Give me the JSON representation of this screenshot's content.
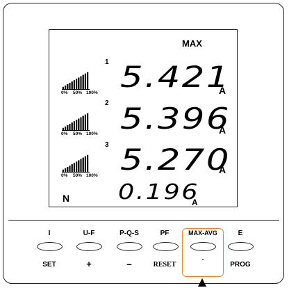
{
  "display": {
    "max_indicator": "MAX",
    "lines": [
      {
        "number": "1",
        "value": "5.421",
        "unit": "A",
        "bar_level": 1.0
      },
      {
        "number": "2",
        "value": "5.396",
        "unit": "A",
        "bar_level": 1.0
      },
      {
        "number": "3",
        "value": "5.270",
        "unit": "A",
        "bar_level": 1.0
      }
    ],
    "bar_scale": {
      "low": "0%",
      "mid": "50%",
      "high": "100%"
    },
    "neutral": {
      "label": "N",
      "value": "0.196",
      "unit": "A"
    }
  },
  "buttons": [
    {
      "top": "I",
      "bottom": "SET"
    },
    {
      "top": "U-F",
      "bottom": "+"
    },
    {
      "top": "P-Q-S",
      "bottom": "–"
    },
    {
      "top": "PF",
      "bottom": "RESET"
    },
    {
      "top": "MAX-AVG",
      "bottom": "."
    },
    {
      "top": "E",
      "bottom": "PROG"
    }
  ],
  "colors": {
    "highlight": "#e08a3a",
    "ink": "#000000"
  },
  "icons": {
    "pointer": "arrow-up-icon",
    "bar_graph": "bar-graph-icon"
  }
}
